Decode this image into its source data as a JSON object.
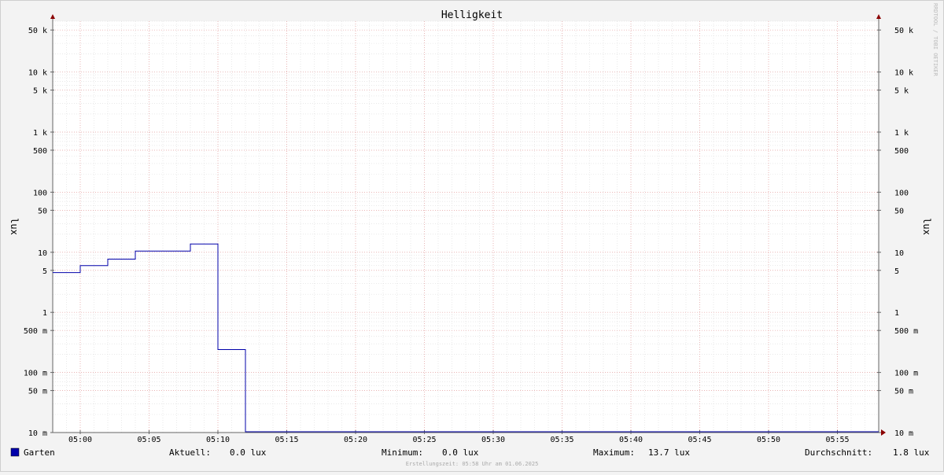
{
  "chart_data": {
    "type": "line",
    "title": "Helligkeit",
    "ylabel": "lux",
    "ylabel_right": "lux",
    "scale": "log",
    "ylim": [
      0.01,
      70000
    ],
    "xlim_minutes": [
      -2,
      58
    ],
    "grid": true,
    "watermark": "RRDTOOL / TOBI OETIKER",
    "y_ticks": [
      {
        "value": 50000,
        "label": "50 k"
      },
      {
        "value": 10000,
        "label": "10 k"
      },
      {
        "value": 5000,
        "label": "5 k"
      },
      {
        "value": 1000,
        "label": "1 k"
      },
      {
        "value": 500,
        "label": "500"
      },
      {
        "value": 100,
        "label": "100"
      },
      {
        "value": 50,
        "label": "50"
      },
      {
        "value": 10,
        "label": "10"
      },
      {
        "value": 5,
        "label": "5"
      },
      {
        "value": 1,
        "label": "1"
      },
      {
        "value": 0.5,
        "label": "500 m"
      },
      {
        "value": 0.1,
        "label": "100 m"
      },
      {
        "value": 0.05,
        "label": "50 m"
      },
      {
        "value": 0.01,
        "label": "10 m"
      }
    ],
    "x_ticks": [
      {
        "minute": 0,
        "label": "05:00"
      },
      {
        "minute": 5,
        "label": "05:05"
      },
      {
        "minute": 10,
        "label": "05:10"
      },
      {
        "minute": 15,
        "label": "05:15"
      },
      {
        "minute": 20,
        "label": "05:20"
      },
      {
        "minute": 25,
        "label": "05:25"
      },
      {
        "minute": 30,
        "label": "05:30"
      },
      {
        "minute": 35,
        "label": "05:35"
      },
      {
        "minute": 40,
        "label": "05:40"
      },
      {
        "minute": 45,
        "label": "05:45"
      },
      {
        "minute": 50,
        "label": "05:50"
      },
      {
        "minute": 55,
        "label": "05:55"
      }
    ],
    "series": [
      {
        "name": "Garten",
        "color": "#0000aa",
        "steps": [
          {
            "from": -2,
            "to": 0,
            "y": 4.6
          },
          {
            "from": 0,
            "to": 2,
            "y": 6.0
          },
          {
            "from": 2,
            "to": 4,
            "y": 7.7
          },
          {
            "from": 4,
            "to": 8,
            "y": 10.5
          },
          {
            "from": 8,
            "to": 10,
            "y": 13.7
          },
          {
            "from": 10,
            "to": 12,
            "y": 0.24
          },
          {
            "from": 12,
            "to": 58,
            "y": 0.0
          }
        ]
      }
    ]
  },
  "legend": {
    "series_name": "Garten",
    "swatch_color": "#0000aa",
    "current_label": "Aktuell:",
    "current_value": "0.0 lux",
    "min_label": "Minimum:",
    "min_value": "0.0 lux",
    "max_label": "Maximum:",
    "max_value": "13.7 lux",
    "avg_label": "Durchschnitt:",
    "avg_value": "1.8 lux"
  },
  "footer": "Erstellungszeit: 05:58 Uhr am 01.06.2025"
}
